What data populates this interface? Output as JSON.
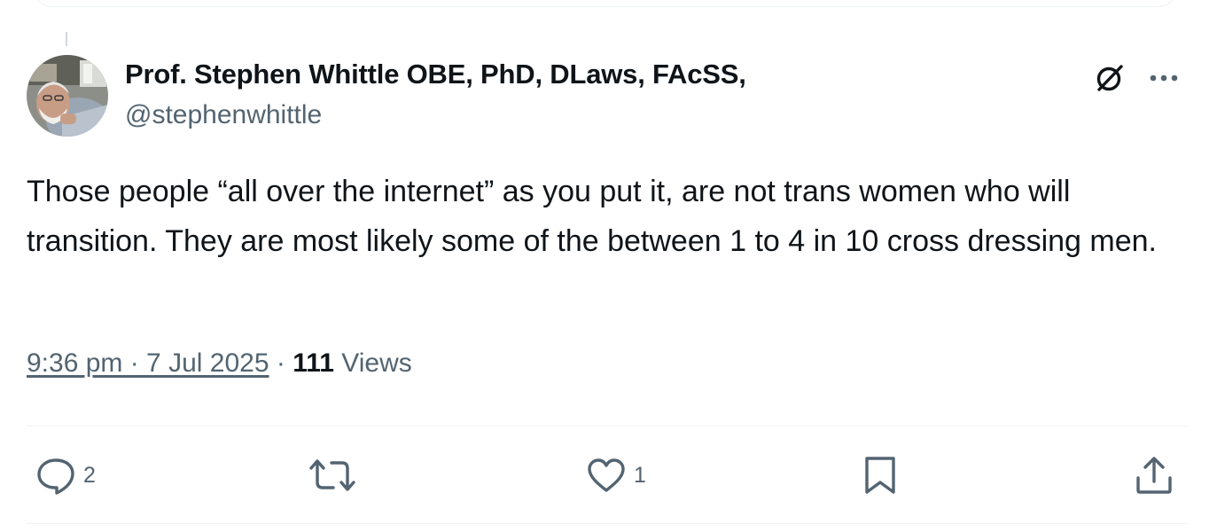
{
  "tweet": {
    "author": {
      "display_name": "Prof. Stephen Whittle OBE, PhD, DLaws, FAcSS,",
      "handle": "@stephenwhittle",
      "avatar_icon": "profile-photo"
    },
    "text": "Those people “all over the internet” as you put it, are not trans women who will transition. They are most likely some of the between 1 to 4 in 10 cross dressing men.",
    "timestamp": "9:36 pm · 7 Jul 2025",
    "separator": " · ",
    "views_count": "111",
    "views_label": " Views"
  },
  "header_actions": {
    "grok_icon": "grok-icon",
    "more_icon": "more-icon"
  },
  "actions": {
    "reply": {
      "icon": "reply-icon",
      "count": "2"
    },
    "repost": {
      "icon": "repost-icon",
      "count": ""
    },
    "like": {
      "icon": "heart-icon",
      "count": "1"
    },
    "bookmark": {
      "icon": "bookmark-icon",
      "count": ""
    },
    "share": {
      "icon": "share-icon",
      "count": ""
    }
  },
  "colors": {
    "text_primary": "#0f1419",
    "text_secondary": "#536471",
    "divider": "#eff3f4"
  }
}
